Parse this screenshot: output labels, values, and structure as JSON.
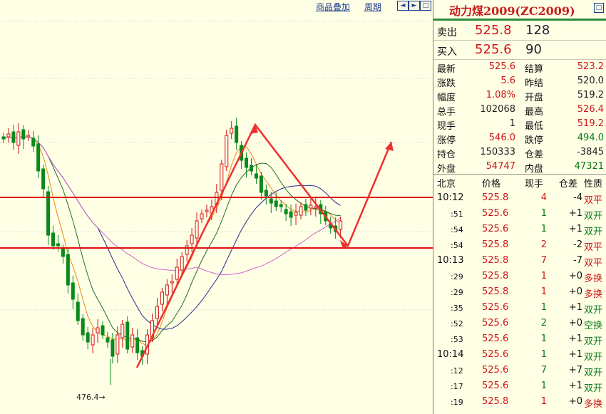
{
  "toolbar": {
    "overlay_label": "商品叠加",
    "period_label": "周期"
  },
  "chart": {
    "low_marker": "476.4"
  },
  "quote": {
    "title": "动力煤2009(ZC2009)",
    "ask": {
      "label": "卖出",
      "price": "525.8",
      "volume": "128"
    },
    "bid": {
      "label": "买入",
      "price": "525.6",
      "volume": "90"
    },
    "stats": [
      {
        "l1": "最新",
        "v1": "525.6",
        "c1": "red",
        "l2": "结算",
        "v2": "523.2",
        "c2": "red"
      },
      {
        "l1": "涨跌",
        "v1": "5.6",
        "c1": "red",
        "l2": "昨结",
        "v2": "520.0",
        "c2": "blk"
      },
      {
        "l1": "幅度",
        "v1": "1.08%",
        "c1": "red",
        "l2": "开盘",
        "v2": "519.2",
        "c2": "blk"
      },
      {
        "l1": "总手",
        "v1": "102068",
        "c1": "blk",
        "l2": "最高",
        "v2": "526.4",
        "c2": "red"
      },
      {
        "l1": "现手",
        "v1": "1",
        "c1": "blk",
        "l2": "最低",
        "v2": "519.2",
        "c2": "red"
      },
      {
        "l1": "涨停",
        "v1": "546.0",
        "c1": "red",
        "l2": "跌停",
        "v2": "494.0",
        "c2": "green"
      },
      {
        "l1": "持仓",
        "v1": "150333",
        "c1": "blk",
        "l2": "仓差",
        "v2": "-3845",
        "c2": "blk"
      },
      {
        "l1": "外盘",
        "v1": "54747",
        "c1": "red",
        "l2": "内盘",
        "v2": "47321",
        "c2": "green"
      }
    ]
  },
  "ticks": {
    "headers": {
      "time": "北京",
      "price": "价格",
      "volume": "现手",
      "oi": "仓差",
      "nature": "性质"
    },
    "rows": [
      {
        "time": "10:12",
        "price": "525.8",
        "vol": "4",
        "oi": "-4",
        "nat": "双平",
        "pc": "red",
        "vc": "red",
        "nc": "red",
        "full": true
      },
      {
        "time": ":51",
        "price": "525.6",
        "vol": "1",
        "oi": "+1",
        "nat": "双开",
        "pc": "red",
        "vc": "green",
        "nc": "green",
        "full": false
      },
      {
        "time": ":54",
        "price": "525.6",
        "vol": "1",
        "oi": "+1",
        "nat": "双开",
        "pc": "red",
        "vc": "green",
        "nc": "green",
        "full": false
      },
      {
        "time": ":54",
        "price": "525.8",
        "vol": "2",
        "oi": "-2",
        "nat": "双平",
        "pc": "red",
        "vc": "red",
        "nc": "red",
        "full": false
      },
      {
        "time": "10:13",
        "price": "525.8",
        "vol": "7",
        "oi": "-7",
        "nat": "双平",
        "pc": "red",
        "vc": "red",
        "nc": "red",
        "full": true
      },
      {
        "time": ":29",
        "price": "525.8",
        "vol": "1",
        "oi": "+0",
        "nat": "多换",
        "pc": "red",
        "vc": "red",
        "nc": "red",
        "full": false
      },
      {
        "time": ":29",
        "price": "525.8",
        "vol": "1",
        "oi": "+0",
        "nat": "多换",
        "pc": "red",
        "vc": "red",
        "nc": "red",
        "full": false
      },
      {
        "time": ":35",
        "price": "525.6",
        "vol": "1",
        "oi": "+1",
        "nat": "双开",
        "pc": "red",
        "vc": "green",
        "nc": "green",
        "full": false
      },
      {
        "time": ":52",
        "price": "525.6",
        "vol": "2",
        "oi": "+0",
        "nat": "空换",
        "pc": "red",
        "vc": "green",
        "nc": "green",
        "full": false
      },
      {
        "time": ":53",
        "price": "525.6",
        "vol": "1",
        "oi": "+1",
        "nat": "双开",
        "pc": "red",
        "vc": "green",
        "nc": "green",
        "full": false
      },
      {
        "time": "10:14",
        "price": "525.6",
        "vol": "1",
        "oi": "+1",
        "nat": "双开",
        "pc": "red",
        "vc": "green",
        "nc": "green",
        "full": true
      },
      {
        "time": ":12",
        "price": "525.6",
        "vol": "7",
        "oi": "+7",
        "nat": "双开",
        "pc": "red",
        "vc": "green",
        "nc": "green",
        "full": false
      },
      {
        "time": ":17",
        "price": "525.6",
        "vol": "1",
        "oi": "+1",
        "nat": "双开",
        "pc": "red",
        "vc": "green",
        "nc": "green",
        "full": false
      },
      {
        "time": ":19",
        "price": "525.8",
        "vol": "1",
        "oi": "+0",
        "nat": "多换",
        "pc": "red",
        "vc": "red",
        "nc": "red",
        "full": false
      }
    ]
  }
}
